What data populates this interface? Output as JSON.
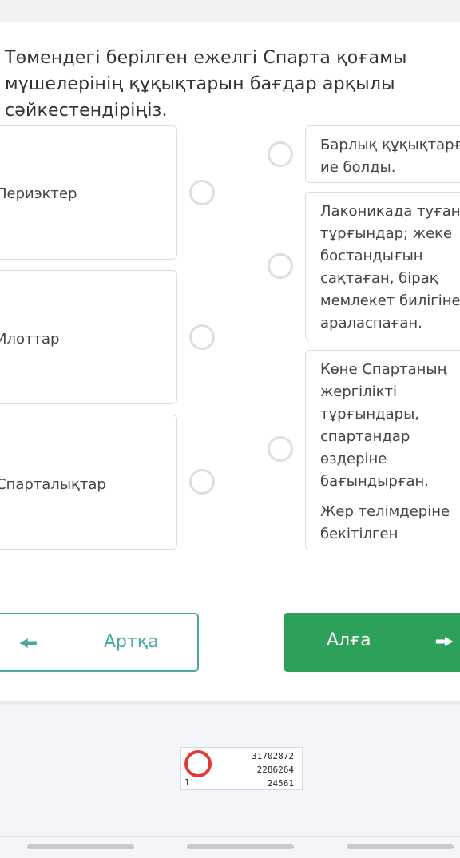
{
  "question": "Төмендегі берілген ежелгі Спарта қоғамы мүшелерінің құқықтарын бағдар арқылы сәйкестендіріңіз.",
  "left_items": [
    "Периэктер",
    "Илоттар",
    "Спарталықтар"
  ],
  "right_items": [
    "Барлық құқықтарға\nие болды.",
    "Лаконикада туған\nтұрғындар; жеке\nбостандығын\nсақтаған, бірақ\nмемлекет билігіне\nараласпаған.",
    "Көне Спартаның\nжергілікті\nтұрғындары,\nспартандар өздеріне\nбағындырған."
  ],
  "right_item_extra": "Жер телімдеріне\nбекітілген\nмемлекеттік құлдар.",
  "buttons": {
    "back": "Артқа",
    "next": "Алға"
  },
  "watermark": {
    "ring_number": "1",
    "lines": [
      "31702872",
      "2286264",
      "24561"
    ]
  },
  "colors": {
    "accent_teal": "#4aa8a0",
    "accent_green": "#2da15a"
  },
  "icons": {
    "back": "arrow-left-icon",
    "next": "arrow-right-icon"
  }
}
